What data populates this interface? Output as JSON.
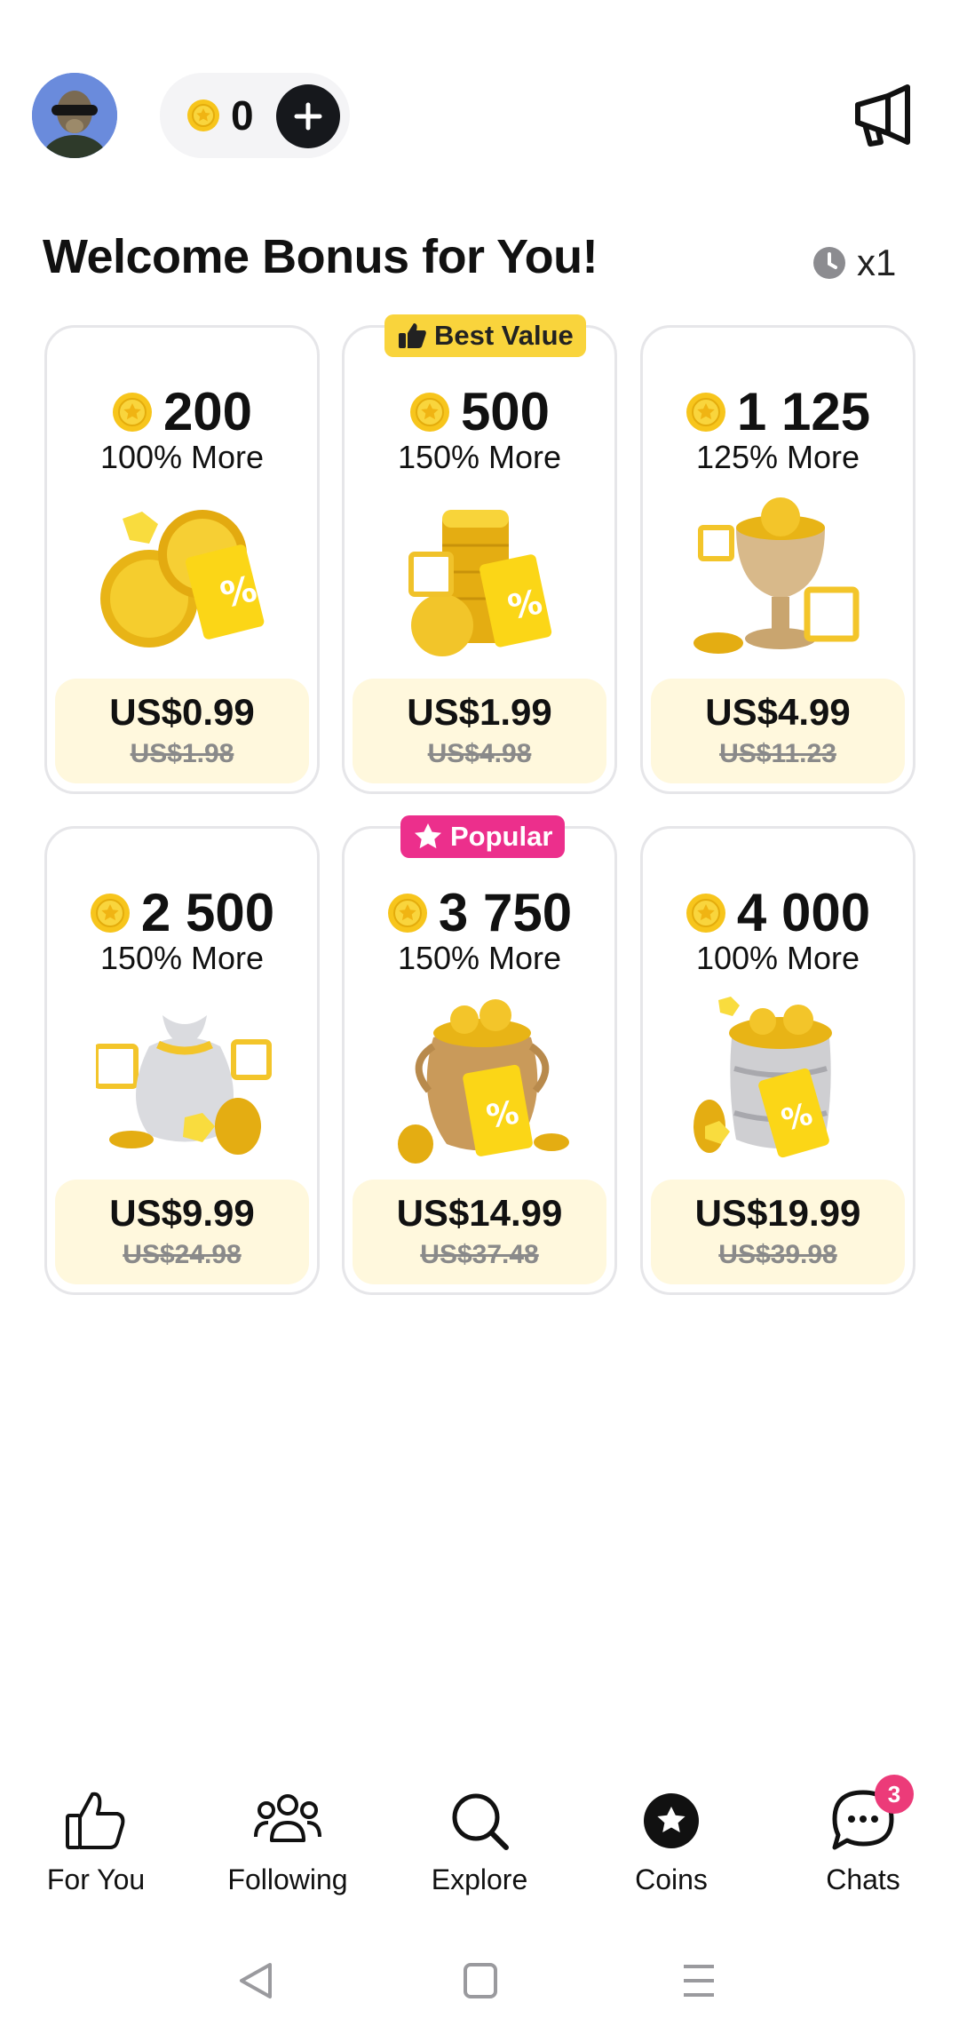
{
  "header": {
    "coin_balance": "0",
    "avatar_icon": "avatar-meerkat-with-sunglasses",
    "add_icon": "plus-icon",
    "announce_icon": "megaphone-icon"
  },
  "welcome": {
    "title": "Welcome Bonus for You!",
    "timer_multiplier": "x1"
  },
  "badges": {
    "best_value": "Best Value",
    "popular": "Popular"
  },
  "packs": [
    {
      "coins": "200",
      "bonus": "100% More",
      "price": "US$0.99",
      "original_price": "US$1.98"
    },
    {
      "coins": "500",
      "bonus": "150% More",
      "price": "US$1.99",
      "original_price": "US$4.98"
    },
    {
      "coins": "1 125",
      "bonus": "125% More",
      "price": "US$4.99",
      "original_price": "US$11.23"
    },
    {
      "coins": "2 500",
      "bonus": "150% More",
      "price": "US$9.99",
      "original_price": "US$24.98"
    },
    {
      "coins": "3 750",
      "bonus": "150% More",
      "price": "US$14.99",
      "original_price": "US$37.48"
    },
    {
      "coins": "4 000",
      "bonus": "100% More",
      "price": "US$19.99",
      "original_price": "US$39.98"
    }
  ],
  "nav": {
    "items": [
      {
        "label": "For You"
      },
      {
        "label": "Following"
      },
      {
        "label": "Explore"
      },
      {
        "label": "Coins"
      },
      {
        "label": "Chats"
      }
    ],
    "chats_badge": "3"
  },
  "colors": {
    "coin_gold": "#f7c51c",
    "price_bg": "#fff8dd",
    "best_value_badge": "#f9d43c",
    "popular_badge": "#ec2f8c",
    "chat_badge": "#ec3b79"
  }
}
